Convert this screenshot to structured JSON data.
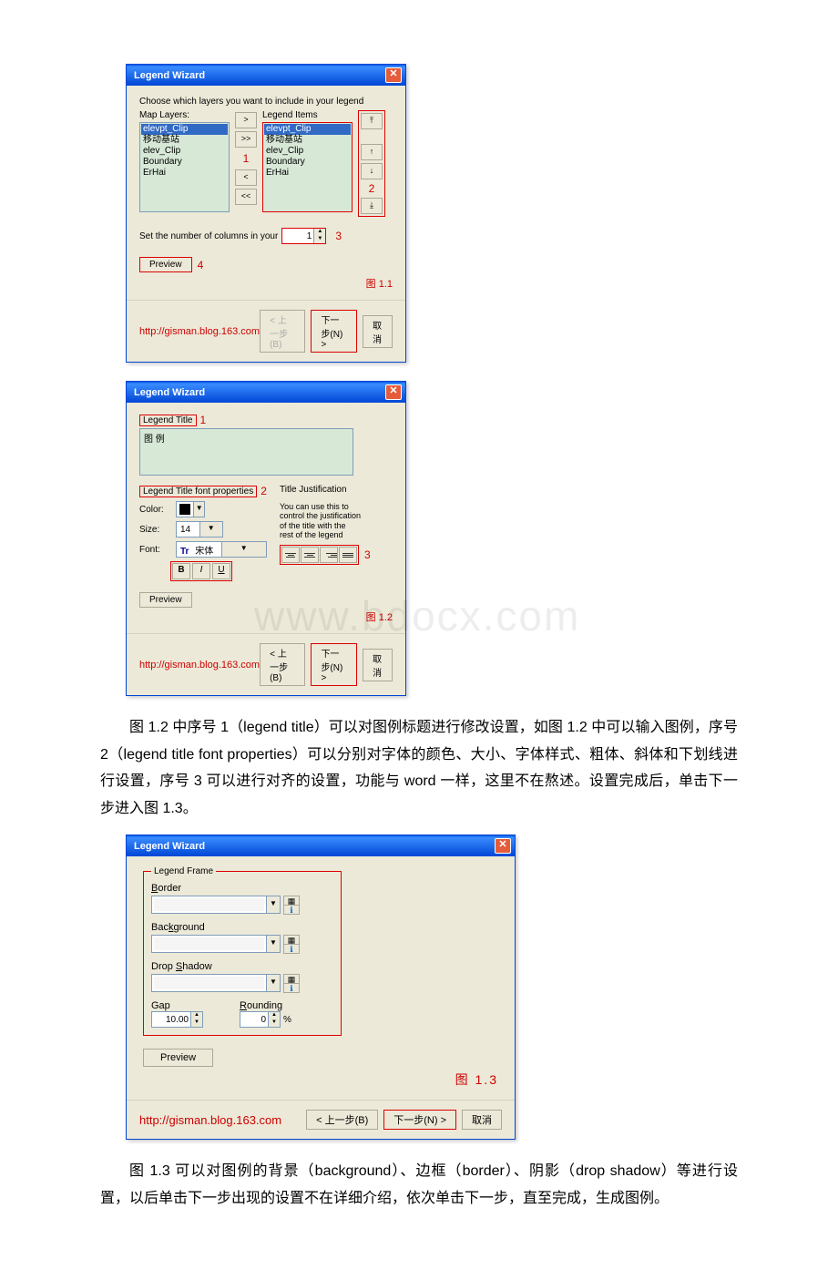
{
  "d1": {
    "title": "Legend Wizard",
    "instr": "Choose which layers you want to include in your legend",
    "mapLayersLabel": "Map Layers:",
    "legendItemsLabel": "Legend Items",
    "layers": [
      "elevpt_Clip",
      "移动基站",
      "elev_Clip",
      "Boundary",
      "ErHai"
    ],
    "btnAdd": ">",
    "btnAddAll": ">>",
    "btnRem": "<",
    "btnRemAll": "<<",
    "btnTop": "↑̄",
    "btnUp": "↑",
    "btnDown": "↓",
    "btnBottom": "↓̲",
    "a1": "1",
    "a2": "2",
    "colsLabel": "Set the number of columns in your",
    "colsVal": "1",
    "a3": "3",
    "preview": "Preview",
    "a4": "4",
    "figLabel": "图 1.1",
    "url": "http://gisman.blog.163.com",
    "back": "< 上一步(B)",
    "next": "下一步(N) >",
    "cancel": "取消"
  },
  "d2": {
    "title": "Legend Wizard",
    "g1": "Legend Title",
    "a1": "1",
    "titleVal": "图 例",
    "g2": "Legend Title font properties",
    "a2": "2",
    "colorLabel": "Color:",
    "sizeLabel": "Size:",
    "sizeVal": "14",
    "fontLabel": "Font:",
    "fontVal": "宋体",
    "bold": "B",
    "italic": "I",
    "under": "U",
    "g3": "Title Justification",
    "justTxt": "You can use this to control the justification of the title with the rest of the legend",
    "a3": "3",
    "preview": "Preview",
    "figLabel": "图 1.2",
    "url": "http://gisman.blog.163.com",
    "back": "< 上一步(B)",
    "next": "下一步(N) >",
    "cancel": "取消"
  },
  "para1": "图 1.2 中序号 1（legend title）可以对图例标题进行修改设置，如图 1.2 中可以输入图例，序号 2（legend title font properties）可以分别对字体的颜色、大小、字体样式、粗体、斜体和下划线进行设置，序号 3 可以进行对齐的设置，功能与 word 一样，这里不在熬述。设置完成后，单击下一步进入图 1.3。",
  "d3": {
    "title": "Legend Wizard",
    "g1": "Legend Frame",
    "borderLabel": "Border",
    "bgLabel": "Background",
    "shadowLabel": "Drop Shadow",
    "gapLabel": "Gap",
    "gapVal": "10.00",
    "roundLabel": "Rounding",
    "roundVal": "0",
    "pct": "%",
    "preview": "Preview",
    "figLabel": "图 1.3",
    "url": "http://gisman.blog.163.com",
    "back": "< 上一步(B)",
    "next": "下一步(N) >",
    "cancel": "取消"
  },
  "para2": "图 1.3 可以对图例的背景（background）、边框（border）、阴影（drop shadow）等进行设置，以后单击下一步出现的设置不在详细介绍，依次单击下一步，直至完成，生成图例。",
  "wm": "www.bdocx.com"
}
